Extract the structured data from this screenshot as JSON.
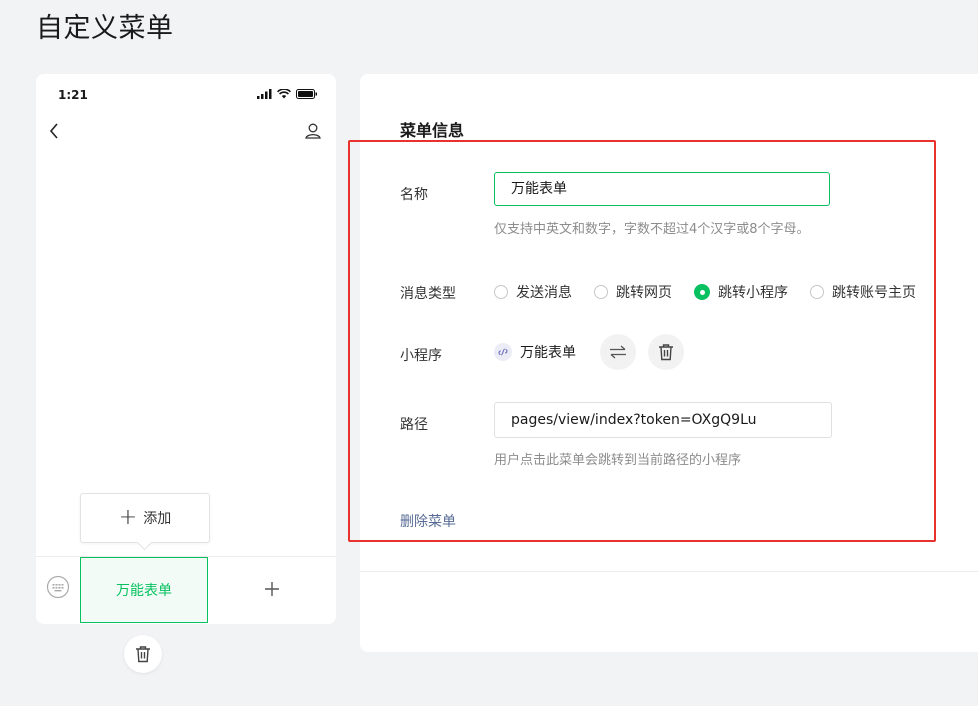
{
  "page": {
    "title": "自定义菜单"
  },
  "phone": {
    "time": "1:21",
    "add_button_label": "添加",
    "menu_items": [
      "万能表单"
    ]
  },
  "panel": {
    "title": "菜单信息",
    "name_label": "名称",
    "name_value": "万能表单",
    "name_hint": "仅支持中英文和数字，字数不超过4个汉字或8个字母。",
    "type_label": "消息类型",
    "type_options": [
      "发送消息",
      "跳转网页",
      "跳转小程序",
      "跳转账号主页"
    ],
    "type_selected": "跳转小程序",
    "miniprogram_label": "小程序",
    "miniprogram_name": "万能表单",
    "path_label": "路径",
    "path_value": "pages/view/index?token=OXgQ9Lu",
    "path_hint": "用户点击此菜单会跳转到当前路径的小程序",
    "delete_link": "删除菜单"
  },
  "colors": {
    "accent": "#07c160",
    "link": "#576b95",
    "highlight": "#e8322c"
  },
  "icons": [
    "back-icon",
    "user-icon",
    "keyboard-icon",
    "plus-icon",
    "trash-icon",
    "miniprogram-icon",
    "swap-icon"
  ]
}
